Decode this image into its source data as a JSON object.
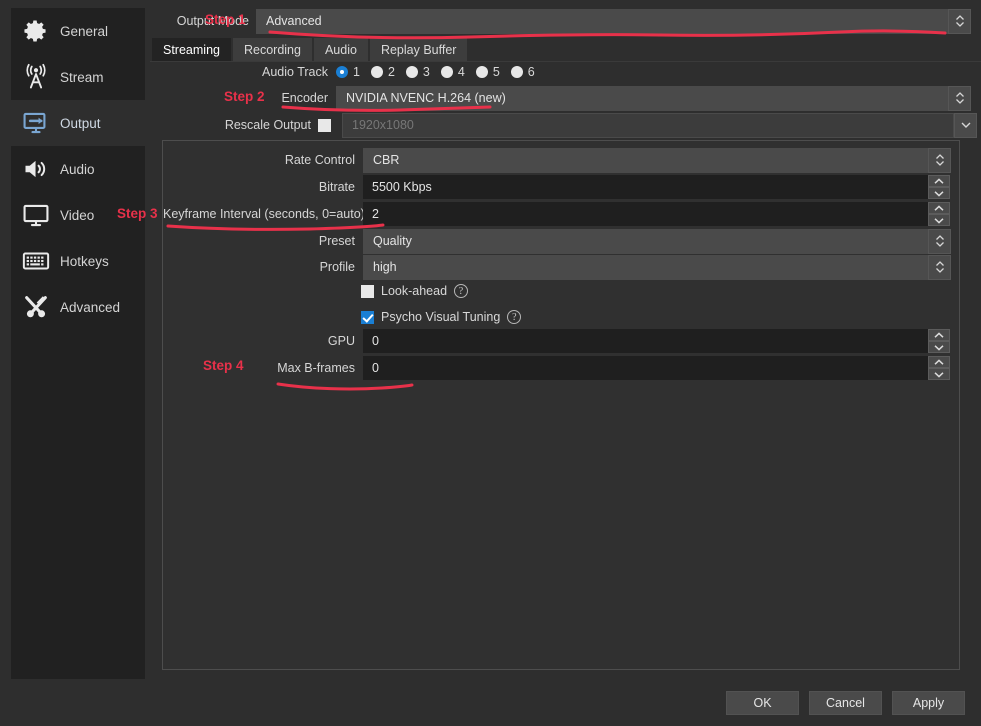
{
  "sidebar": {
    "items": [
      {
        "label": "General",
        "icon": "gear-icon",
        "selected": false
      },
      {
        "label": "Stream",
        "icon": "broadcast-icon",
        "selected": false
      },
      {
        "label": "Output",
        "icon": "monitor-arrow-icon",
        "selected": true
      },
      {
        "label": "Audio",
        "icon": "speaker-icon",
        "selected": false
      },
      {
        "label": "Video",
        "icon": "display-icon",
        "selected": false
      },
      {
        "label": "Hotkeys",
        "icon": "keyboard-icon",
        "selected": false
      },
      {
        "label": "Advanced",
        "icon": "tools-icon",
        "selected": false
      }
    ]
  },
  "output_mode": {
    "label": "Output Mode",
    "value": "Advanced"
  },
  "tabs": [
    {
      "label": "Streaming",
      "active": true
    },
    {
      "label": "Recording",
      "active": false
    },
    {
      "label": "Audio",
      "active": false
    },
    {
      "label": "Replay Buffer",
      "active": false
    }
  ],
  "audio_track": {
    "label": "Audio Track",
    "options": [
      "1",
      "2",
      "3",
      "4",
      "5",
      "6"
    ],
    "selected": "1"
  },
  "encoder": {
    "label": "Encoder",
    "value": "NVIDIA NVENC H.264 (new)"
  },
  "rescale_output": {
    "label": "Rescale Output",
    "checked": false,
    "value": "1920x1080",
    "enabled": false
  },
  "encoder_settings": {
    "rate_control": {
      "label": "Rate Control",
      "value": "CBR"
    },
    "bitrate": {
      "label": "Bitrate",
      "value": "5500 Kbps"
    },
    "keyframe_interval": {
      "label": "Keyframe Interval (seconds, 0=auto)",
      "value": "2"
    },
    "preset": {
      "label": "Preset",
      "value": "Quality"
    },
    "profile": {
      "label": "Profile",
      "value": "high"
    },
    "look_ahead": {
      "label": "Look-ahead",
      "checked": false,
      "help": "?"
    },
    "psycho_visual": {
      "label": "Psycho Visual Tuning",
      "checked": true,
      "help": "?"
    },
    "gpu": {
      "label": "GPU",
      "value": "0"
    },
    "max_bframes": {
      "label": "Max B-frames",
      "value": "0"
    }
  },
  "dialog_buttons": {
    "ok": "OK",
    "cancel": "Cancel",
    "apply": "Apply"
  },
  "annotations": {
    "color": "#e8314a",
    "steps": [
      {
        "label": "Step 1",
        "target": "Output Mode"
      },
      {
        "label": "Step 2",
        "target": "Encoder"
      },
      {
        "label": "Step 3",
        "target": "Keyframe Interval (seconds, 0=auto)"
      },
      {
        "label": "Step 4",
        "target": "Max B-frames"
      }
    ]
  }
}
